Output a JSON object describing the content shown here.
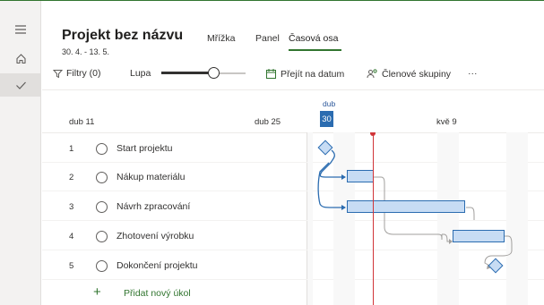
{
  "project": {
    "title": "Projekt bez názvu",
    "dates": "30. 4. - 13. 5."
  },
  "views": [
    {
      "label": "Mřížka"
    },
    {
      "label": "Panel"
    },
    {
      "label": "Časová osa"
    }
  ],
  "toolbar": {
    "filters_label": "Filtry (0)",
    "zoom_label": "Lupa",
    "zoom_level": 0.62,
    "goto_date_label": "Přejít na datum",
    "member_groups_label": "Členové skupiny",
    "more_label": "···"
  },
  "timeline": {
    "date_left": "dub 11",
    "date_mid": "dub 25",
    "today_month": "dub",
    "today_day": "30",
    "date_right": "kvě 9"
  },
  "tasks": [
    {
      "num": "1",
      "name": "Start projektu"
    },
    {
      "num": "2",
      "name": "Nákup materiálu"
    },
    {
      "num": "3",
      "name": "Návrh zpracování"
    },
    {
      "num": "4",
      "name": "Zhotovení výrobku"
    },
    {
      "num": "5",
      "name": "Dokončení projektu"
    }
  ],
  "add_task_label": "Přidat nový úkol",
  "colors": {
    "accent": "#31752f",
    "today": "#d13438",
    "bar_fill": "#c7dcf4",
    "bar_border": "#2b6cb0"
  }
}
